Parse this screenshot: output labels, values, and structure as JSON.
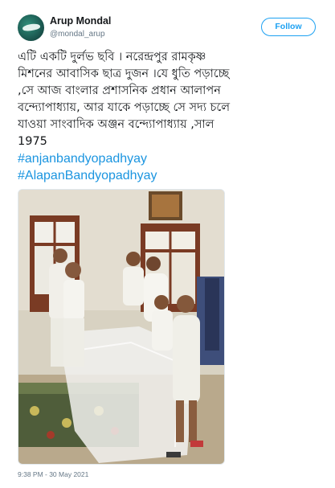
{
  "user": {
    "display_name": "Arup Mondal",
    "handle": "@mondal_arup"
  },
  "follow_label": "Follow",
  "tweet": {
    "lines": [
      "এটি একটি দুর্লভ ছবি । নরেন্দ্রপুর রামকৃষ্ণ",
      "মিশনের আবাসিক ছাত্র দুজন ।যে ধুতি পড়াচ্ছে",
      ",সে আজ বাংলার প্রশাসনিক প্রধান আলাপন",
      "বন্দ্যোপাধ্যায়, আর যাকে পড়াচ্ছে সে সদ্য চলে",
      "যাওয়া সাংবাদিক অঞ্জন বন্দ্যোপাধ্যায় ,সাল",
      "1975"
    ],
    "hashtags": [
      "#anjanbandyopadhyay",
      "#AlapanBandyopadhyay"
    ]
  },
  "timestamp": "9:38 PM - 30 May 2021",
  "colors": {
    "link": "#1b95e0",
    "follow": "#1da1f2",
    "secondary_text": "#657786"
  }
}
